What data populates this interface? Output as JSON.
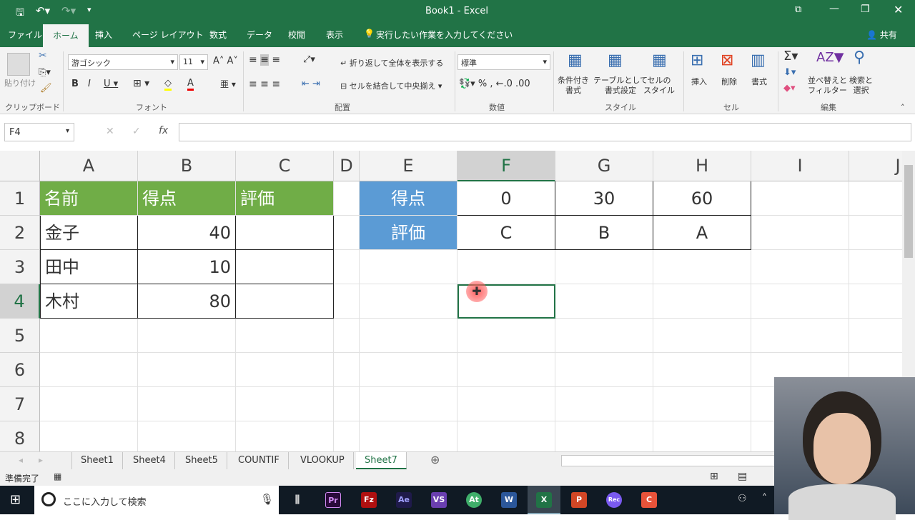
{
  "window": {
    "title": "Book1 - Excel"
  },
  "ribbon_tabs": [
    "ファイル",
    "ホーム",
    "挿入",
    "ページ レイアウト",
    "数式",
    "データ",
    "校閲",
    "表示"
  ],
  "tell_me": "実行したい作業を入力してください",
  "share": "共有",
  "ribbon": {
    "paste": "貼り付け",
    "clipboard": "クリップボード",
    "font_name": "游ゴシック",
    "font_size": "11",
    "font": "フォント",
    "wrap": "折り返して全体を表示する",
    "merge": "セルを結合して中央揃え",
    "alignment": "配置",
    "number_format": "標準",
    "number": "数値",
    "cond_format": "条件付き\n書式",
    "table_format": "テーブルとして\n書式設定",
    "cell_style": "セルの\nスタイル",
    "styles": "スタイル",
    "insert": "挿入",
    "delete": "削除",
    "format": "書式",
    "cells": "セル",
    "sort": "並べ替えと\nフィルター",
    "find": "検索と\n選択",
    "editing": "編集"
  },
  "name_box": "F4",
  "formula": "",
  "columns": [
    "A",
    "B",
    "C",
    "D",
    "E",
    "F",
    "G",
    "H",
    "I",
    "J"
  ],
  "rows": [
    "1",
    "2",
    "3",
    "4",
    "5",
    "6",
    "7",
    "8"
  ],
  "selected": {
    "col": "F",
    "row": "4"
  },
  "cells": {
    "A1": "名前",
    "B1": "得点",
    "C1": "評価",
    "A2": "金子",
    "B2": "40",
    "A3": "田中",
    "B3": "10",
    "A4": "木村",
    "B4": "80",
    "E1": "得点",
    "F1": "0",
    "G1": "30",
    "H1": "60",
    "E2": "評価",
    "F2": "C",
    "G2": "B",
    "H2": "A"
  },
  "sheets": [
    "Sheet1",
    "Sheet4",
    "Sheet5",
    "COUNTIF",
    "VLOOKUP",
    "Sheet7"
  ],
  "active_sheet": "Sheet7",
  "status": "準備完了",
  "taskbar": {
    "search": "ここに入力して検索",
    "apps": [
      "Pr",
      "Fz",
      "Ae",
      "VS",
      "At",
      "W",
      "X",
      "P",
      "Rec",
      "C"
    ]
  },
  "colors": {
    "green": "#217346",
    "header_fill": "#70ad47",
    "lookup_fill": "#5b9bd5"
  }
}
